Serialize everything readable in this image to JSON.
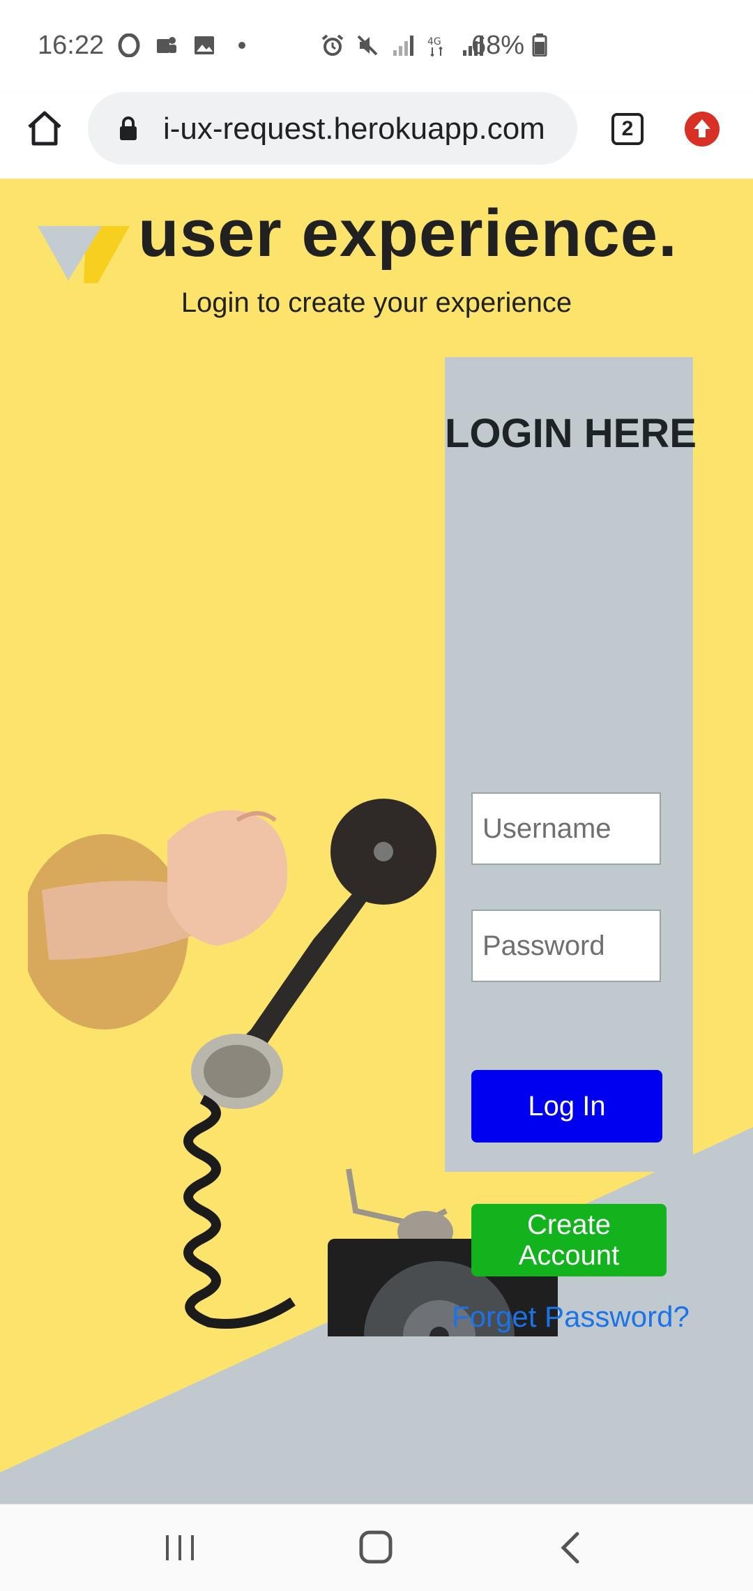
{
  "status_bar": {
    "time": "16:22",
    "battery": "68%",
    "left_icons": [
      "opera-icon",
      "teams-icon",
      "gallery-icon",
      "dot-icon"
    ],
    "right_icons": [
      "alarm-icon",
      "mute-icon",
      "signal-icon",
      "4g-icon",
      "signal-icon"
    ]
  },
  "browser": {
    "url": "i-ux-request.herokuapp.com",
    "tab_count": "2"
  },
  "header": {
    "title": "user experience.",
    "subtitle": "Login to create your experience"
  },
  "login": {
    "heading": "LOGIN HERE",
    "username_placeholder": "Username",
    "password_placeholder": "Password",
    "login_label": "Log In",
    "create_account_label": "Create\nAccount",
    "forgot_label": "Forget Password?"
  },
  "colors": {
    "page_yellow": "#fce36c",
    "panel_grey": "#bfc9ce",
    "login_blue": "#0000f0",
    "create_green": "#12b31d",
    "link_blue": "#1a73e8"
  }
}
